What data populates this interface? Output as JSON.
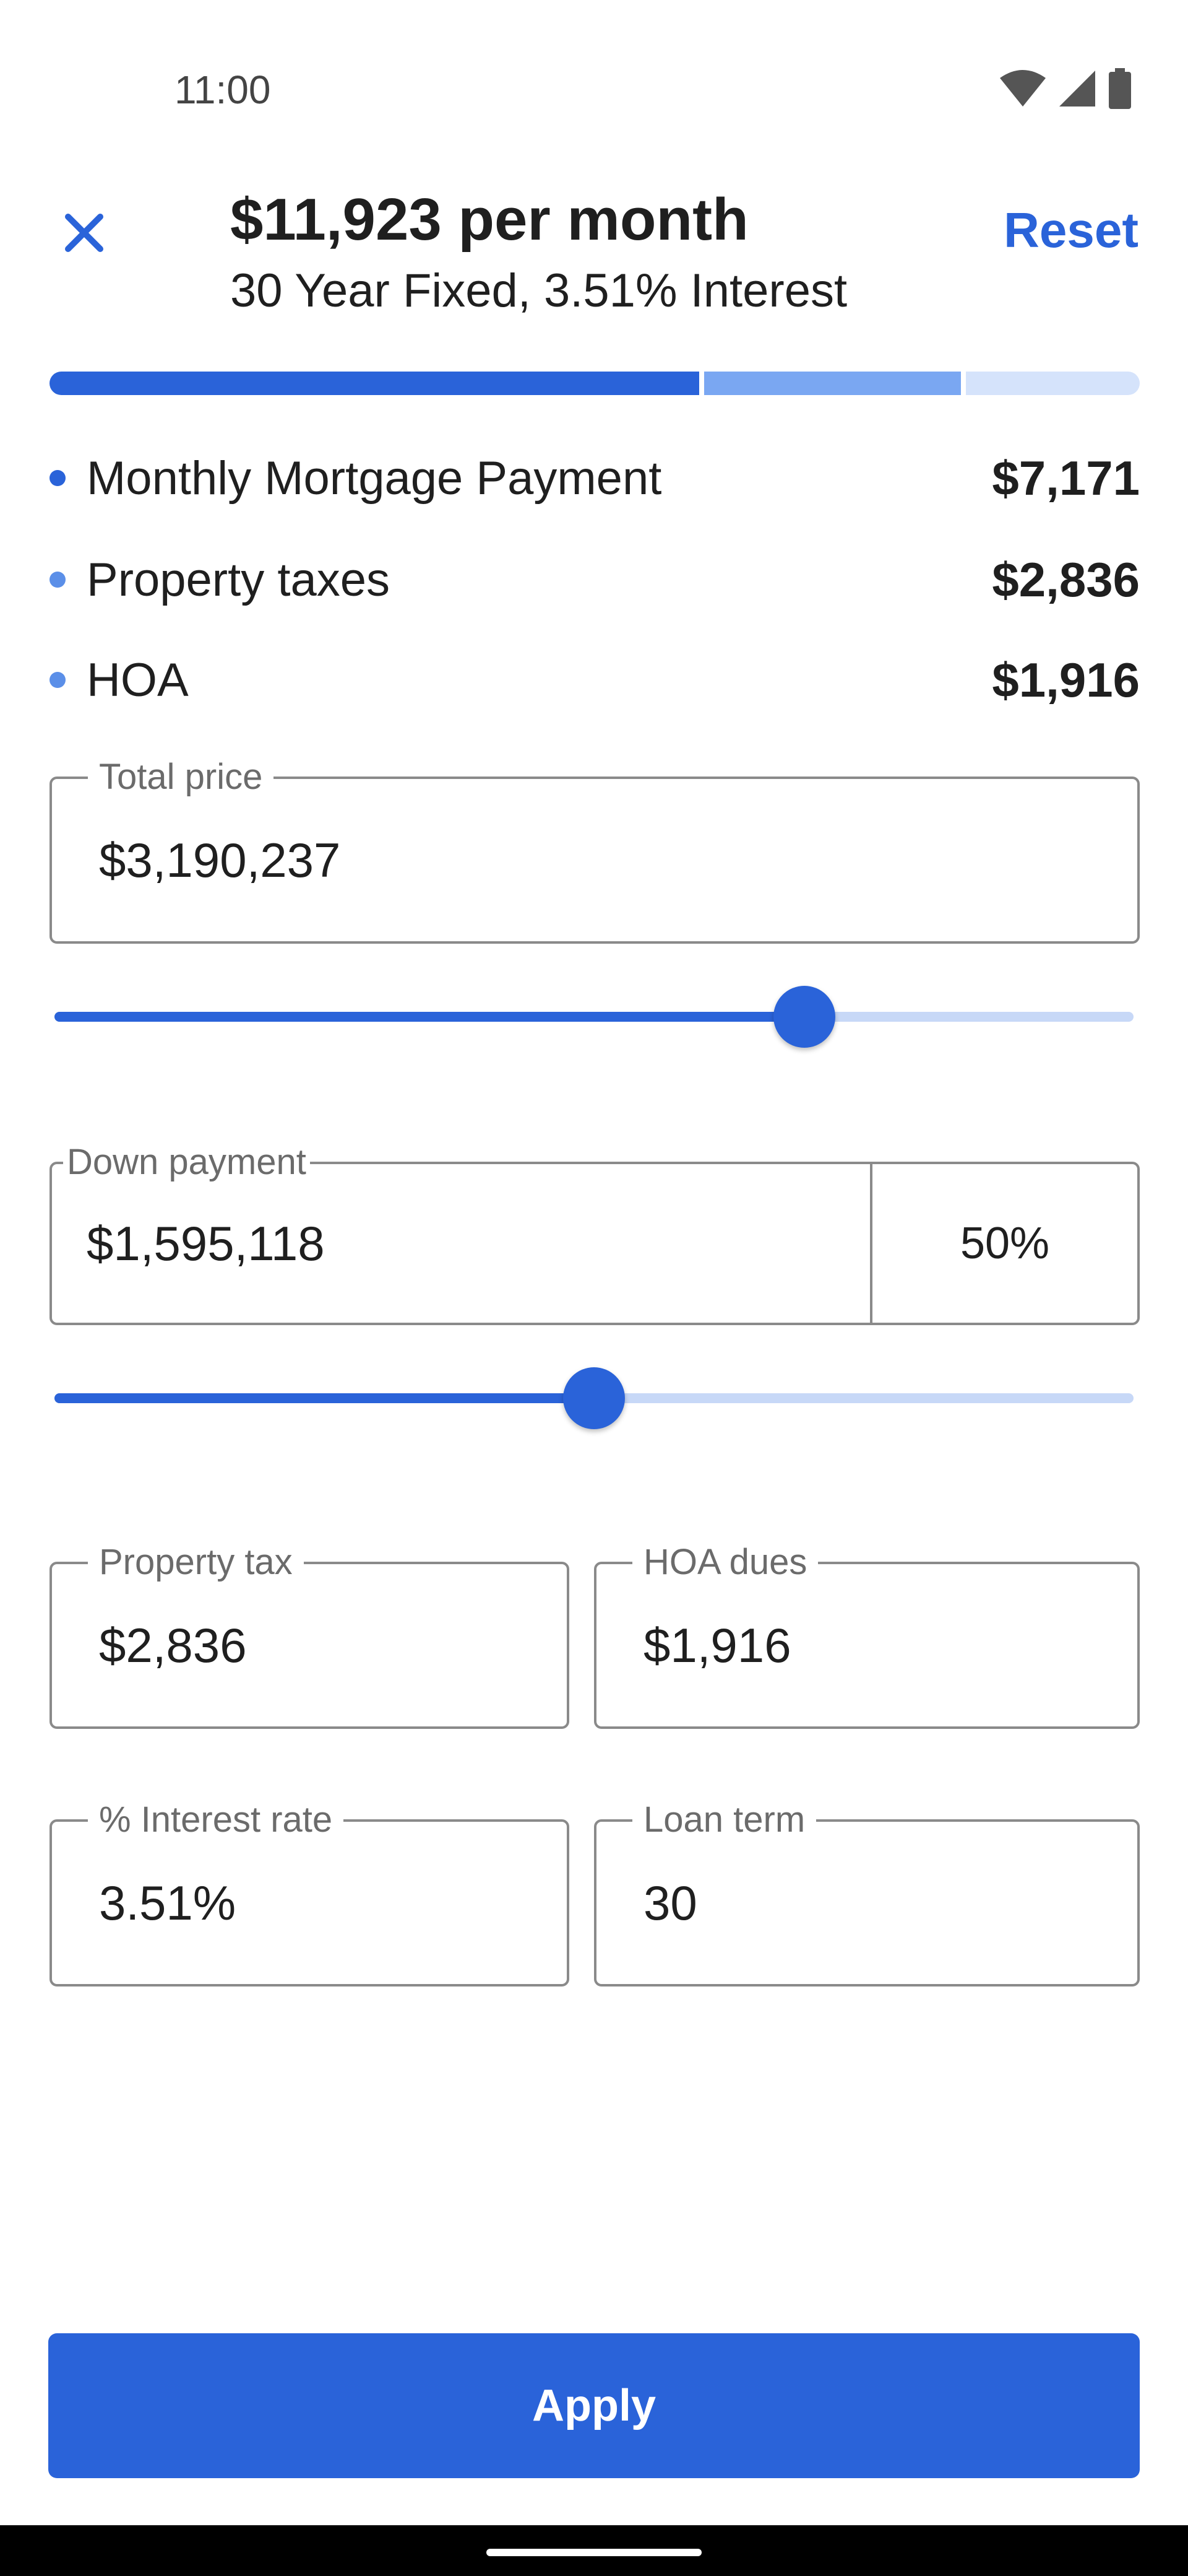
{
  "status_bar": {
    "time": "11:00",
    "icons": [
      "wifi-icon",
      "signal-icon",
      "battery-icon"
    ]
  },
  "header": {
    "title": "$11,923 per month",
    "subtitle": "30 Year Fixed, 3.51% Interest",
    "close_icon": "close-icon",
    "reset_label": "Reset"
  },
  "breakdown": {
    "bar": [
      {
        "name": "Monthly Mortgage Payment",
        "value": 7171,
        "color": "#2a63d9"
      },
      {
        "name": "Property taxes",
        "value": 2836,
        "color": "#7aa7f2"
      },
      {
        "name": "HOA",
        "value": 1916,
        "color": "#d5e3fb"
      }
    ],
    "items": [
      {
        "label": "Monthly Mortgage Payment",
        "value": "$7,171",
        "color": "#2a63d9"
      },
      {
        "label": "Property taxes",
        "value": "$2,836",
        "color": "#5b8fe8"
      },
      {
        "label": "HOA",
        "value": "$1,916",
        "color": "#5b8fe8"
      }
    ]
  },
  "total_price": {
    "label": "Total price",
    "value": "$3,190,237",
    "slider_fraction": 0.695
  },
  "down_payment": {
    "label": "Down payment",
    "value": "$1,595,118",
    "percent": "50%",
    "slider_fraction": 0.5
  },
  "property_tax": {
    "label": "Property tax",
    "value": "$2,836"
  },
  "hoa_dues": {
    "label": "HOA dues",
    "value": "$1,916"
  },
  "interest_rate": {
    "label": "% Interest rate",
    "value": "3.51%"
  },
  "loan_term": {
    "label": "Loan term",
    "value": "30"
  },
  "apply": {
    "label": "Apply"
  },
  "colors": {
    "accent": "#2a63d9",
    "track": "#c7d8f7"
  }
}
